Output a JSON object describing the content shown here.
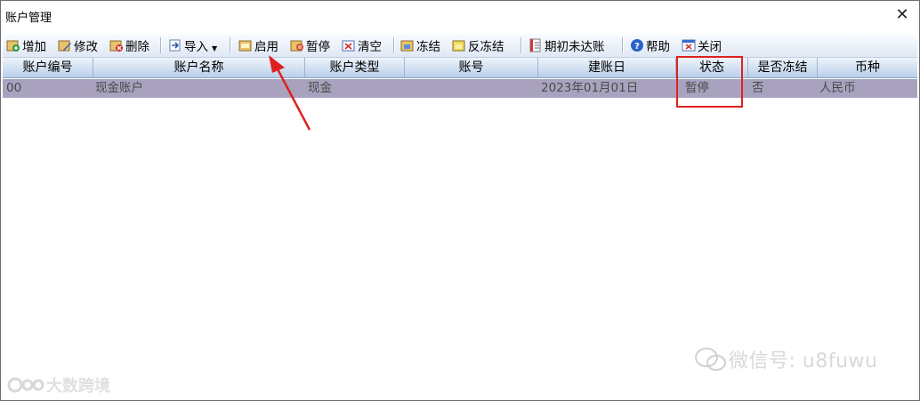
{
  "window": {
    "title": "账户管理",
    "close_glyph": "✕"
  },
  "toolbar": {
    "add": "增加",
    "edit": "修改",
    "delete": "删除",
    "import": "导入",
    "enable": "启用",
    "pause": "暂停",
    "clear": "清空",
    "freeze": "冻结",
    "unfreeze": "反冻结",
    "opening_balance": "期初未达账",
    "help": "帮助",
    "close": "关闭"
  },
  "table": {
    "columns": [
      "账户编号",
      "账户名称",
      "账户类型",
      "账号",
      "建账日",
      "状态",
      "是否冻结",
      "币种"
    ],
    "rows": [
      {
        "code": "00",
        "name": "现金账户",
        "type": "现金",
        "account_no": "",
        "open_date": "2023年01月01日",
        "status": "暂停",
        "frozen": "否",
        "currency": "人民币"
      }
    ]
  },
  "watermark": {
    "right": "微信号: u8fuwu",
    "left": "大数跨境"
  },
  "colors": {
    "selected_row": "#a9a2bf",
    "annotation": "#e02020",
    "toolbar_top": "#fafcff",
    "toolbar_bottom": "#dfe8f5"
  },
  "icons": [
    "add-icon",
    "edit-icon",
    "delete-icon",
    "import-icon",
    "enable-icon",
    "pause-icon",
    "clear-icon",
    "freeze-icon",
    "unfreeze-icon",
    "opening-balance-icon",
    "help-icon",
    "close-icon"
  ]
}
